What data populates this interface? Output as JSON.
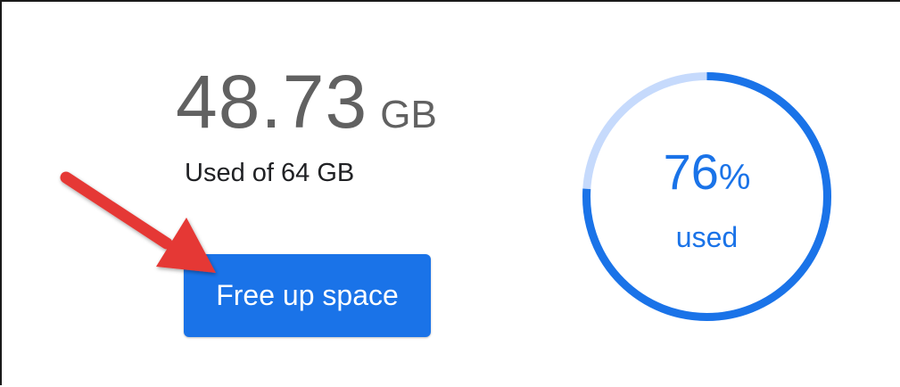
{
  "storage": {
    "used_value": "48.73",
    "used_unit": "GB",
    "subtitle": "Used of 64 GB",
    "used_fraction": 0.76
  },
  "button": {
    "label": "Free up space"
  },
  "ring": {
    "percent_value": "76",
    "percent_sign": "%",
    "label": "used"
  },
  "colors": {
    "accent": "#1a73e8",
    "ring_track": "#c6dafc",
    "arrow": "#e53935",
    "text_muted": "#616161",
    "text_primary": "#202124"
  },
  "icons": {
    "annotation": "red-arrow-icon"
  }
}
